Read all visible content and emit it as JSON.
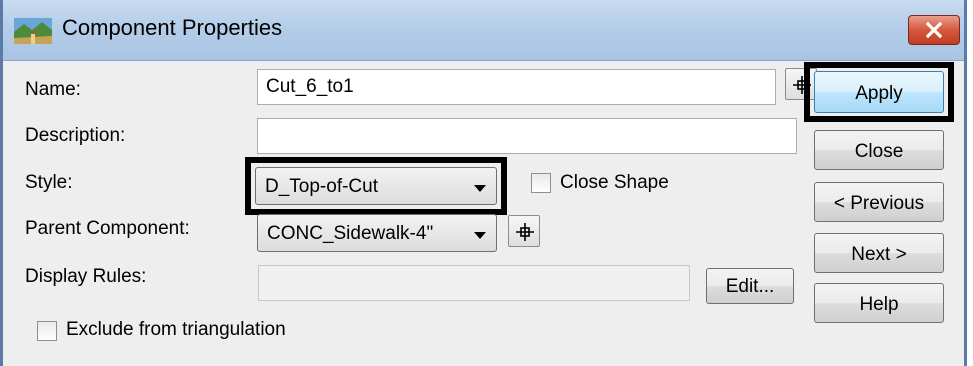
{
  "window": {
    "title": "Component Properties"
  },
  "form": {
    "name_label": "Name:",
    "name_value": "Cut_6_to1",
    "description_label": "Description:",
    "description_value": "",
    "style_label": "Style:",
    "style_value": "D_Top-of-Cut",
    "close_shape_label": "Close Shape",
    "close_shape_checked": false,
    "parent_label": "Parent Component:",
    "parent_value": "CONC_Sidewalk-4\"",
    "display_rules_label": "Display Rules:",
    "display_rules_value": "",
    "edit_label": "Edit...",
    "exclude_label": "Exclude from triangulation",
    "exclude_checked": false
  },
  "buttons": {
    "apply": "Apply",
    "close": "Close",
    "previous": "< Previous",
    "next": "Next >",
    "help": "Help"
  },
  "icons": {
    "title": "road-template-icon",
    "pick": "crosshair-pick-icon",
    "close": "close-x-icon"
  },
  "colors": {
    "titlebar": "#b4cde9",
    "close_button": "#c8462b",
    "apply_button": "#bee6fd",
    "highlight": "#000000"
  }
}
